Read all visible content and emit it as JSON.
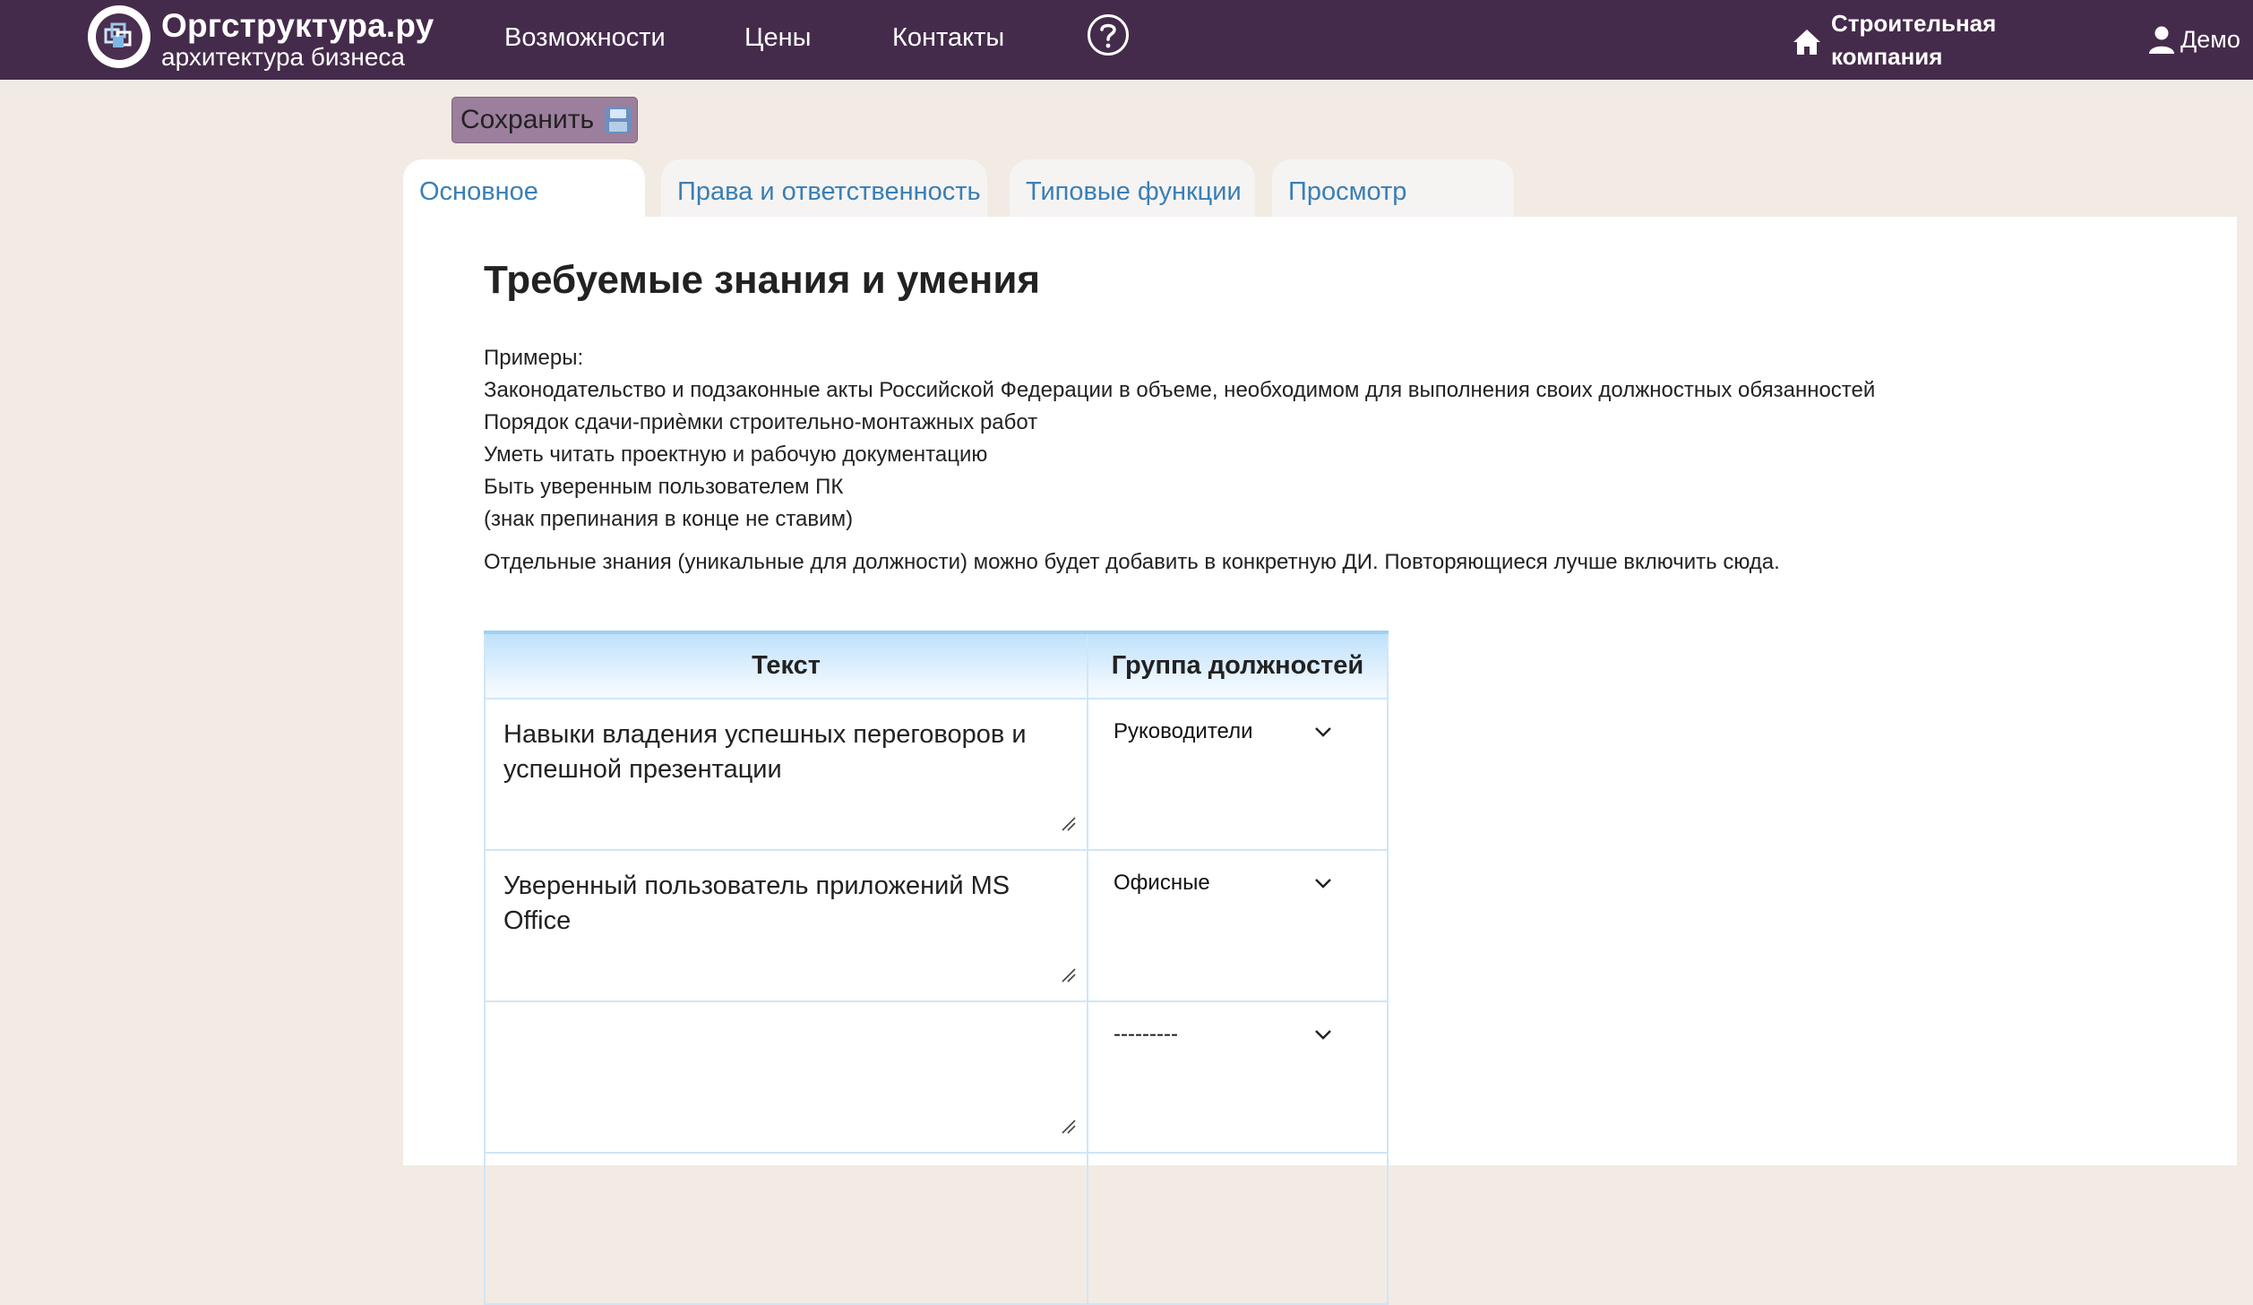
{
  "navbar": {
    "brand_name": "Оргструктура.ру",
    "brand_tagline": "архитектура бизнеса",
    "links": [
      "Возможности",
      "Цены",
      "Контакты"
    ],
    "help_icon": "question-circle-icon",
    "company_icon": "home-icon",
    "company_name": "Строительная компания",
    "user_icon": "user-icon",
    "user_name": "Демо",
    "background_color": "#452b4b"
  },
  "toolbar": {
    "save_label": "Сохранить",
    "save_icon": "save-icon",
    "save_color": "#9c7f9c"
  },
  "tabs": [
    {
      "label": "Основное",
      "active": true
    },
    {
      "label": "Права и ответственность",
      "active": false
    },
    {
      "label": "Типовые функции",
      "active": false
    },
    {
      "label": "Просмотр",
      "active": false
    }
  ],
  "main": {
    "title": "Требуемые знания и умения",
    "examples": [
      "Примеры:",
      "Законодательство и подзаконные акты Российской Федерации в объеме, необходимом для выполнения своих должностных обязанностей",
      "Порядок сдачи-приѐмки строительно-монтажных работ",
      "Уметь читать проектную и рабочую документацию",
      "Быть уверенным пользователем ПК",
      "(знак препинания в конце не ставим)"
    ],
    "note": "Отдельные знания (уникальные для должности) можно будет добавить в конкретную ДИ. Повторяющиеся лучше включить сюда."
  },
  "table": {
    "headers": [
      "Текст",
      "Группа должностей"
    ],
    "rows": [
      {
        "text": "Навыки владения успешных переговоров и успешной презентации",
        "group": "Руководители"
      },
      {
        "text": "Уверенный пользователь приложений MS Office",
        "group": "Офисные"
      },
      {
        "text": "",
        "group": "---------"
      }
    ],
    "header_accent": "#bfe1fb",
    "link_color": "#3a7fb5"
  }
}
